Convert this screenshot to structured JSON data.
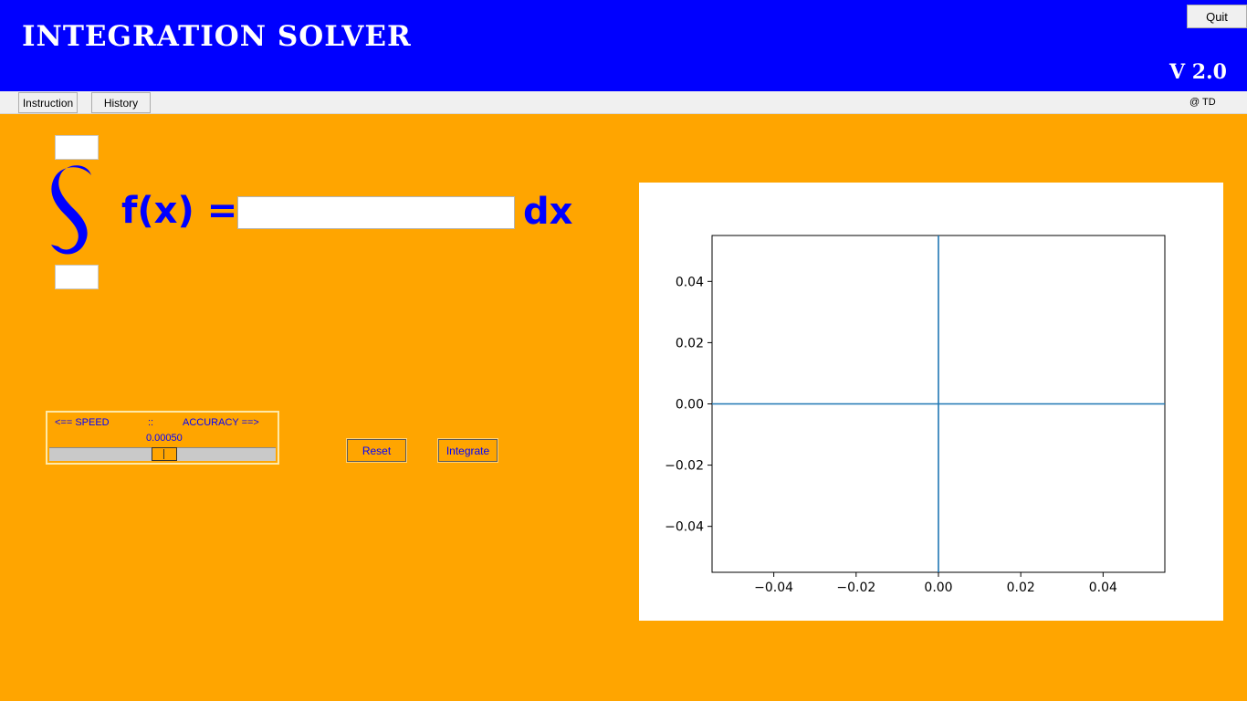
{
  "header": {
    "title": "INTEGRATION SOLVER",
    "version": "V 2.0",
    "quit_label": "Quit",
    "background": "#0000ff"
  },
  "menu": {
    "instruction_label": "Instruction",
    "history_label": "History",
    "credit": "@ TD"
  },
  "integral": {
    "upper_limit": "",
    "lower_limit": "",
    "fx_label": "f(x) =",
    "function_value": "",
    "dx_label": "dx",
    "color": "#0000ff"
  },
  "slider": {
    "left_label": "<== SPEED",
    "separator": "::",
    "right_label": "ACCURACY ==>",
    "value": "0.00050"
  },
  "buttons": {
    "reset_label": "Reset",
    "integrate_label": "Integrate"
  },
  "chart_data": {
    "type": "line",
    "title": "",
    "xlabel": "",
    "ylabel": "",
    "xlim": [
      -0.055,
      0.055
    ],
    "ylim": [
      -0.055,
      0.055
    ],
    "x_ticks": [
      "−0.04",
      "−0.02",
      "0.00",
      "0.02",
      "0.04"
    ],
    "x_tick_values": [
      -0.04,
      -0.02,
      0.0,
      0.02,
      0.04
    ],
    "y_ticks": [
      "0.04",
      "0.02",
      "0.00",
      "−0.02",
      "−0.04"
    ],
    "y_tick_values": [
      0.04,
      0.02,
      0.0,
      -0.02,
      -0.04
    ],
    "lines": [
      {
        "x": [
          -0.055,
          0.055
        ],
        "y": [
          0,
          0
        ]
      },
      {
        "x": [
          0,
          0
        ],
        "y": [
          -0.055,
          0.055
        ]
      }
    ],
    "line_color": "#1f77b4",
    "grid": false
  }
}
